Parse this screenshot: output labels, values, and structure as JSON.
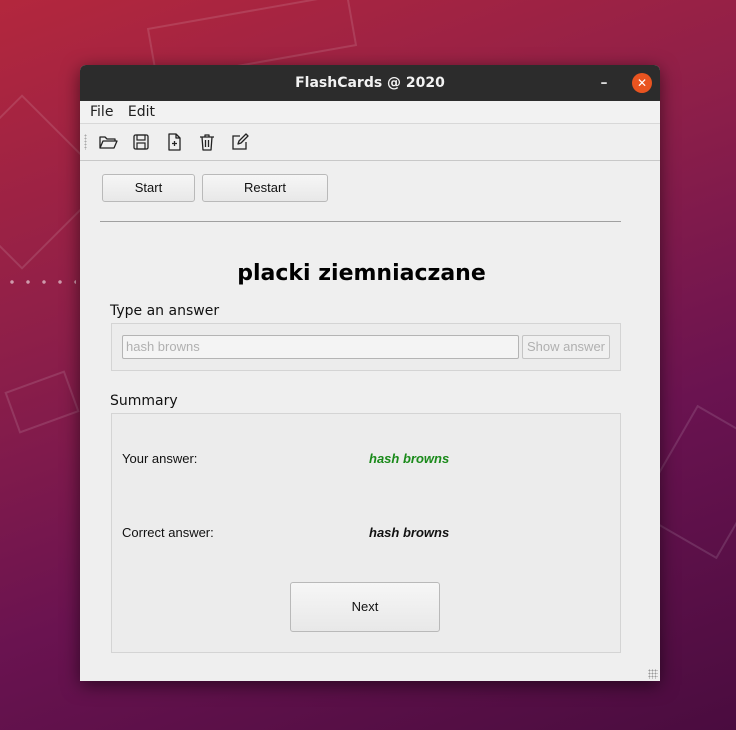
{
  "window": {
    "title": "FlashCards @ 2020",
    "minimize_glyph": "–",
    "close_glyph": "✕"
  },
  "menu": {
    "file": "File",
    "edit": "Edit"
  },
  "toolbar": {
    "icons": [
      "open-folder-icon",
      "save-icon",
      "new-file-icon",
      "delete-icon",
      "edit-icon"
    ]
  },
  "controls": {
    "start": "Start",
    "restart": "Restart"
  },
  "card": {
    "word": "placki ziemniaczane"
  },
  "answer": {
    "label": "Type an answer",
    "value": "",
    "placeholder": "hash browns",
    "show_answer": "Show answer"
  },
  "summary": {
    "label": "Summary",
    "your_answer_label": "Your answer:",
    "your_answer": "hash browns",
    "correct_answer_label": "Correct answer:",
    "correct_answer": "hash browns",
    "next": "Next"
  },
  "colors": {
    "correct": "#1a8a1a",
    "close": "#e95420",
    "titlebar": "#2c2c2c"
  }
}
